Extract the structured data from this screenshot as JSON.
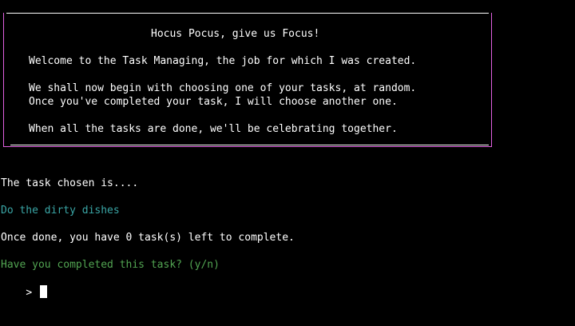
{
  "banner": {
    "title": "Hocus Pocus, give us Focus!",
    "welcome": "Welcome to the Task Managing, the job for which I was created.",
    "intro_line1": "We shall now begin with choosing one of your tasks, at random.",
    "intro_line2": "Once you've completed your task, I will choose another one.",
    "closing": "When all the tasks are done, we'll be celebrating together."
  },
  "output": {
    "chosen_label": "The task chosen is....",
    "task_name": "Do the dirty dishes",
    "remaining": "Once done, you have 0 task(s) left to complete.",
    "question": "Have you completed this task? (y/n)",
    "prompt": ">"
  },
  "colors": {
    "background": "#000000",
    "text": "#ffffff",
    "task": "#3aa6a6",
    "question": "#52a552",
    "border": "#e060e0"
  }
}
